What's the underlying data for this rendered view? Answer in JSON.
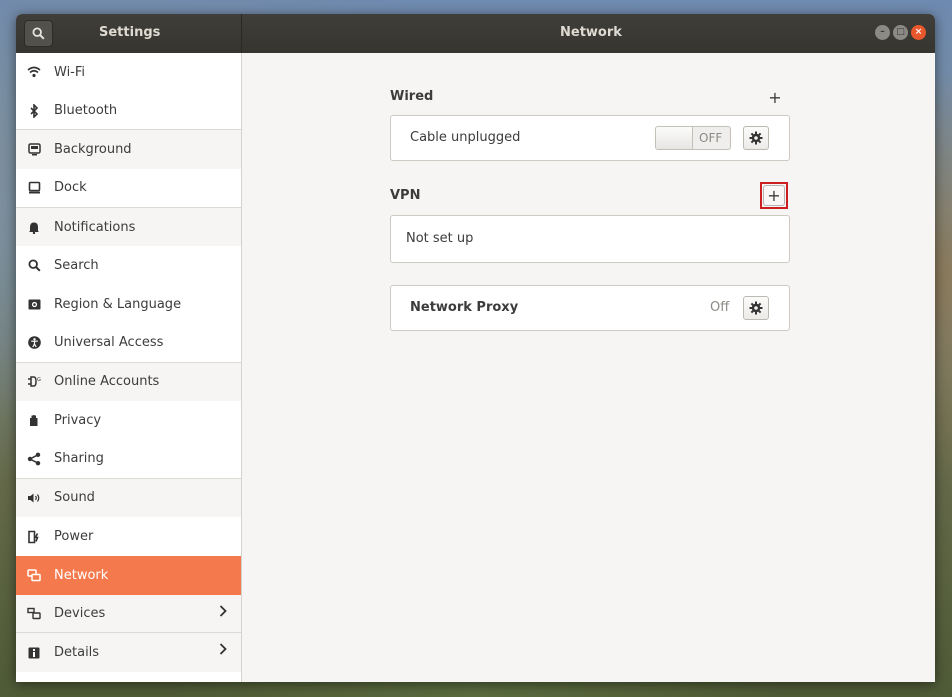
{
  "window": {
    "left_title": "Settings",
    "center_title": "Network"
  },
  "sidebar": {
    "items": [
      {
        "label": "Wi-Fi",
        "icon": "wifi-icon"
      },
      {
        "label": "Bluetooth",
        "icon": "bluetooth-icon"
      },
      {
        "label": "Background",
        "icon": "background-icon"
      },
      {
        "label": "Dock",
        "icon": "dock-icon"
      },
      {
        "label": "Notifications",
        "icon": "bell-icon"
      },
      {
        "label": "Search",
        "icon": "search-icon"
      },
      {
        "label": "Region & Language",
        "icon": "region-icon"
      },
      {
        "label": "Universal Access",
        "icon": "accessibility-icon"
      },
      {
        "label": "Online Accounts",
        "icon": "online-accounts-icon"
      },
      {
        "label": "Privacy",
        "icon": "hand-icon"
      },
      {
        "label": "Sharing",
        "icon": "share-icon"
      },
      {
        "label": "Sound",
        "icon": "speaker-icon"
      },
      {
        "label": "Power",
        "icon": "power-icon"
      },
      {
        "label": "Network",
        "icon": "network-icon",
        "active": true
      },
      {
        "label": "Devices",
        "icon": "devices-icon"
      },
      {
        "label": "Details",
        "icon": "info-icon"
      }
    ]
  },
  "wired": {
    "title": "Wired",
    "add": "+",
    "connection": "Cable unplugged",
    "switch": "OFF"
  },
  "vpn": {
    "title": "VPN",
    "add": "+",
    "empty": "Not set up"
  },
  "proxy": {
    "label": "Network Proxy",
    "status": "Off"
  },
  "colors": {
    "accent": "#f47a4d",
    "titlebar": "#3b3a36",
    "highlight_box": "#cc1f1f"
  }
}
